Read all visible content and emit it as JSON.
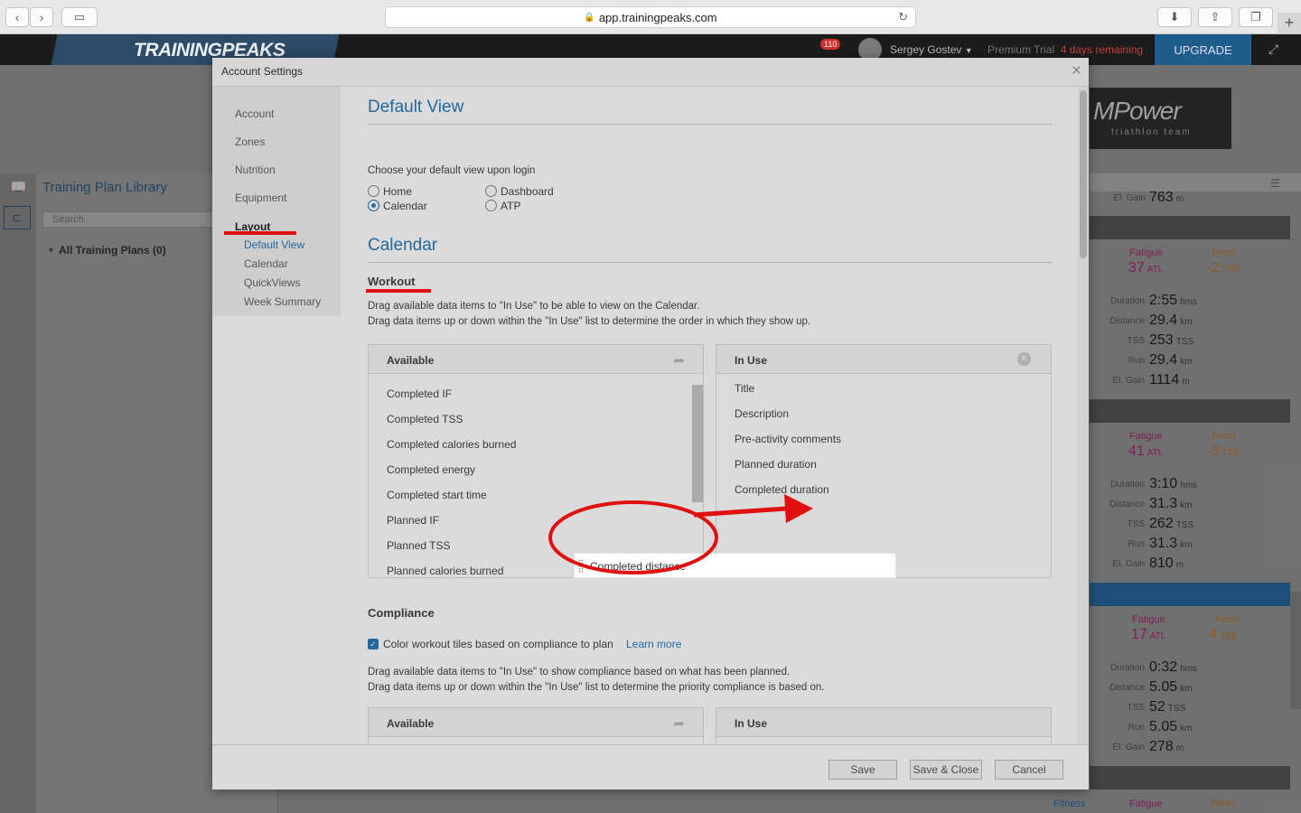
{
  "browser": {
    "url": "app.trainingpeaks.com",
    "new_tab_symbol": "+"
  },
  "header": {
    "logo": "TRAININGPEAKS",
    "notifications": "110",
    "user": "Sergey Gostev",
    "trial_label": "Premium Trial",
    "trial_remaining": "4 days remaining",
    "upgrade": "UPGRADE"
  },
  "background": {
    "library_title": "Training Plan Library",
    "search_placeholder": "Search",
    "all_plans": "All Training Plans (0)",
    "sponsor": {
      "name": "MPower",
      "tagline": "triathlon team"
    },
    "top_partial": {
      "label": "El. Gain",
      "value": "763",
      "unit": "m"
    },
    "weeks": [
      {
        "fatigue": "37",
        "fatigue_unit": "ATL",
        "form": "-2",
        "form_unit": "TSB",
        "duration": "2:55",
        "duration_unit": "hms",
        "distance": "29.4",
        "distance_unit": "km",
        "tss": "253",
        "tss_unit": "TSS",
        "run": "29.4",
        "run_unit": "km",
        "elgain": "1114",
        "elgain_unit": "m"
      },
      {
        "fatigue": "41",
        "fatigue_unit": "ATL",
        "form": "-3",
        "form_unit": "TSB",
        "duration": "3:10",
        "duration_unit": "hms",
        "distance": "31.3",
        "distance_unit": "km",
        "tss": "262",
        "tss_unit": "TSS",
        "run": "31.3",
        "run_unit": "km",
        "elgain": "810",
        "elgain_unit": "m"
      },
      {
        "fatigue": "17",
        "fatigue_unit": "ATL",
        "form": "4",
        "form_unit": "TSB",
        "duration": "0:32",
        "duration_unit": "hms",
        "distance": "5.05",
        "distance_unit": "km",
        "tss": "52",
        "tss_unit": "TSS",
        "run": "5.05",
        "run_unit": "km",
        "elgain": "278",
        "elgain_unit": "m"
      }
    ],
    "labels": {
      "fatigue": "Fatigue",
      "form": "Form",
      "fitness": "Fitness",
      "duration": "Duration",
      "distance": "Distance",
      "tss": "TSS",
      "run": "Run",
      "elgain": "El. Gain"
    }
  },
  "modal": {
    "title": "Account Settings",
    "close": "×",
    "nav": [
      "Account",
      "Zones",
      "Nutrition",
      "Equipment",
      "Layout"
    ],
    "subnav": [
      "Default View",
      "Calendar",
      "QuickViews",
      "Week Summary"
    ],
    "default_view": {
      "heading": "Default View",
      "prompt": "Choose your default view upon login",
      "options": [
        "Home",
        "Calendar",
        "Dashboard",
        "ATP"
      ],
      "selected": "Calendar"
    },
    "calendar": {
      "heading": "Calendar",
      "workout_heading": "Workout",
      "instr1": "Drag available data items to \"In Use\" to be able to view on the Calendar.",
      "instr2": "Drag data items up or down within the \"In Use\" list to determine the order in which they show up.",
      "available_title": "Available",
      "in_use_title": "In Use",
      "available": [
        "Completed IF",
        "Completed TSS",
        "Completed calories burned",
        "Completed energy",
        "Completed start time",
        "Planned IF",
        "Planned TSS",
        "Planned calories burned"
      ],
      "in_use": [
        "Title",
        "Description",
        "Pre-activity comments",
        "Planned duration",
        "Completed duration"
      ],
      "dragging": "Completed distance"
    },
    "compliance": {
      "heading": "Compliance",
      "checkbox_label": "Color workout tiles based on compliance to plan",
      "learn_more": "Learn more",
      "instr1": "Drag available data items to \"In Use\" to show compliance based on what has been planned.",
      "instr2": "Drag data items up or down within the \"In Use\" list to determine the priority compliance is based on.",
      "available_title": "Available",
      "in_use_title": "In Use"
    },
    "buttons": {
      "save": "Save",
      "save_close": "Save & Close",
      "cancel": "Cancel"
    }
  },
  "annotation_color": "#e01010"
}
